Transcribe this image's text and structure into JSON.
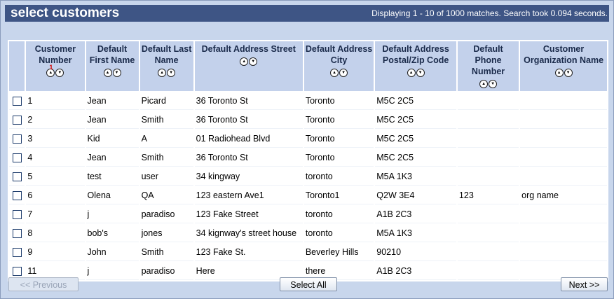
{
  "title": "select customers",
  "status": "Displaying 1 - 10 of 1000 matches. Search took 0.094 seconds.",
  "columns": [
    {
      "label": "Customer Number",
      "sort_rank": "1"
    },
    {
      "label": "Default First Name"
    },
    {
      "label": "Default Last Name"
    },
    {
      "label": "Default Address Street"
    },
    {
      "label": "Default Address City"
    },
    {
      "label": "Default Address Postal/Zip Code"
    },
    {
      "label": "Default Phone Number"
    },
    {
      "label": "Customer Organization Name"
    }
  ],
  "rows": [
    [
      "1",
      "Jean",
      "Picard",
      "36 Toronto St",
      "Toronto",
      "M5C 2C5",
      "",
      ""
    ],
    [
      "2",
      "Jean",
      "Smith",
      "36 Toronto St",
      "Toronto",
      "M5C 2C5",
      "",
      ""
    ],
    [
      "3",
      "Kid",
      "A",
      "01 Radiohead Blvd",
      "Toronto",
      "M5C 2C5",
      "",
      ""
    ],
    [
      "4",
      "Jean",
      "Smith",
      "36 Toronto St",
      "Toronto",
      "M5C 2C5",
      "",
      ""
    ],
    [
      "5",
      "test",
      "user",
      "34 kingway",
      "toronto",
      "M5A 1K3",
      "",
      ""
    ],
    [
      "6",
      "Olena",
      "QA",
      "123 eastern Ave1",
      "Toronto1",
      "Q2W 3E4",
      "123",
      "org name"
    ],
    [
      "7",
      "j",
      "paradiso",
      "123 Fake Street",
      "toronto",
      "A1B 2C3",
      "",
      ""
    ],
    [
      "8",
      "bob's",
      "jones",
      "34 kignway's street house",
      "toronto",
      "M5A 1K3",
      "",
      ""
    ],
    [
      "9",
      "John",
      "Smith",
      "123 Fake St.",
      "Beverley Hills",
      "90210",
      "",
      ""
    ],
    [
      "11",
      "j",
      "paradiso",
      "Here",
      "there",
      "A1B 2C3",
      "",
      ""
    ]
  ],
  "buttons": {
    "previous": "<< Previous",
    "select_all": "Select All",
    "next": "Next >>"
  },
  "icons": {
    "sort_ascending": "sort-ascending-icon",
    "sort_descending": "sort-descending-icon"
  },
  "colors": {
    "title_bar": "#3e5585",
    "background": "#c8d6ec",
    "header_cell": "#c3d1eb"
  }
}
